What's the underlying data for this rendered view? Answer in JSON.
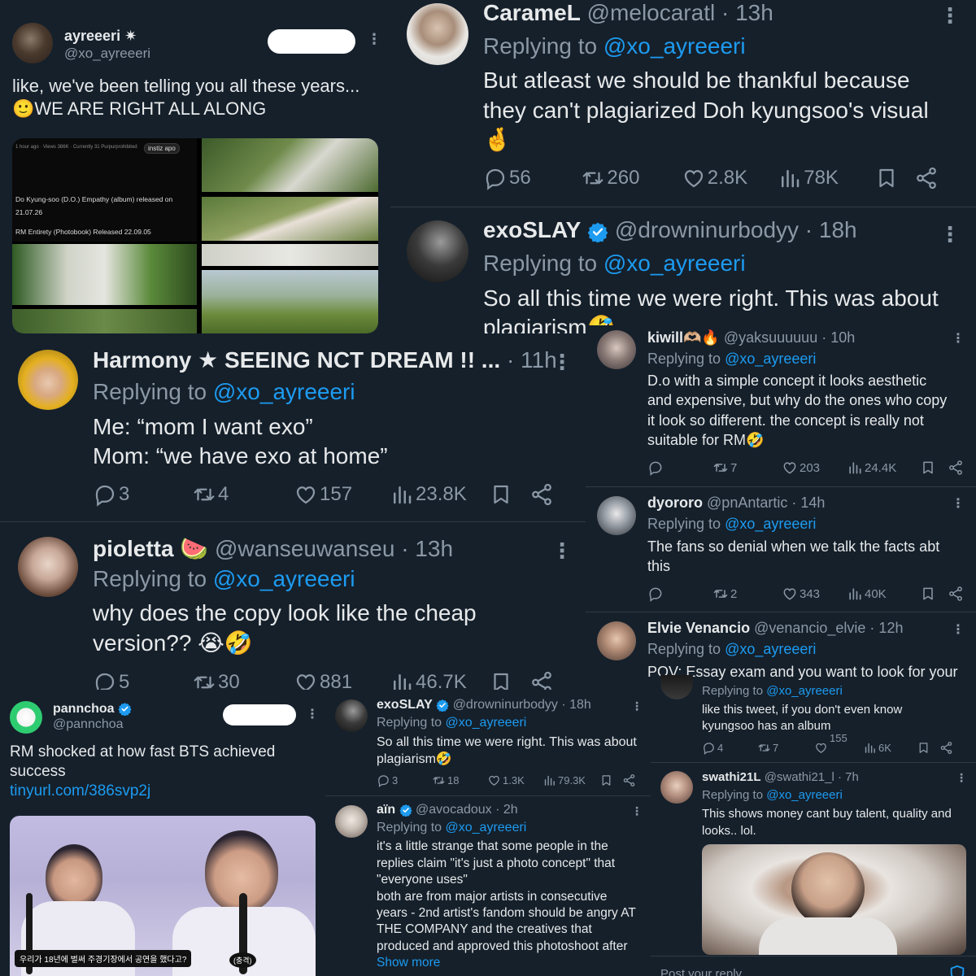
{
  "p1": {
    "name": "ayreeeri ✷",
    "handle": "@xo_ayreeeri",
    "text1": "like, we've been telling you all these years...",
    "text2": "🙂WE ARE RIGHT ALL ALONG",
    "img": {
      "top_left": "1 hour ago  ·  Views 386K · Currently 31  Purpurprohibited",
      "tag": "instiz apo",
      "cap1": "Do Kyung-soo (D.O.) Empathy (album) released on",
      "cap2": "21.07.26",
      "cap3": "RM Entirety (Photobook) Released 22.09.05"
    }
  },
  "p2": {
    "name": "CarameL",
    "meta": "@melocaratl · 13h",
    "replying": "Replying to",
    "reply_to": "@xo_ayreeeri",
    "text1": "But atleast we should be thankful because",
    "text2": "they can't plagiarized Doh kyungsoo's visual",
    "text3": "🤞",
    "actions": {
      "reply": "56",
      "rt": "260",
      "like": "2.8K",
      "views": "78K"
    }
  },
  "p3": {
    "name": "exoSLAY",
    "meta": "@drowninurbodyy · 18h",
    "replying": "Replying to",
    "reply_to": "@xo_ayreeeri",
    "text1": "So all this time we were right. This was about",
    "text2": "plagiarism🤣"
  },
  "p4": {
    "name": "Harmony ★ SEEING NCT DREAM !! ...",
    "meta": "· 11h",
    "replying": "Replying to",
    "reply_to": "@xo_ayreeeri",
    "text1": "Me: “mom I want exo”",
    "text2": "Mom: “we have exo at home”",
    "actions": {
      "reply": "3",
      "rt": "4",
      "like": "157",
      "views": "23.8K"
    }
  },
  "p5": {
    "name": "pioletta 🍉",
    "meta": "@wanseuwanseu · 13h",
    "replying": "Replying to",
    "reply_to": "@xo_ayreeeri",
    "text1": "why does the copy look like the cheap",
    "text2": "version?? 😭🤣",
    "actions": {
      "reply": "5",
      "rt": "30",
      "like": "881",
      "views": "46.7K"
    }
  },
  "p6": {
    "kiwill": {
      "name": "kiwill🫶🏼🔥",
      "meta": "@yaksuuuuuu · 10h",
      "replying": "Replying to",
      "reply_to": "@xo_ayreeeri",
      "lines": [
        "D.o with a simple concept it looks aesthetic",
        "and expensive, but why do the ones who copy",
        "it look so different. the concept is really not",
        "suitable for RM🤣"
      ],
      "actions": {
        "reply": "",
        "rt": "7",
        "like": "203",
        "views": "24.4K"
      }
    },
    "dyororo": {
      "name": "dyororo",
      "meta": "@pnAntartic · 14h",
      "replying": "Replying to",
      "reply_to": "@xo_ayreeeri",
      "lines": [
        "The fans so denial when we talk the facts abt",
        "this"
      ],
      "actions": {
        "reply": "",
        "rt": "2",
        "like": "343",
        "views": "40K"
      }
    },
    "elvie": {
      "name": "Elvie Venancio",
      "meta": "@venancio_elvie · 12h",
      "replying": "Replying to",
      "reply_to": "@xo_ayreeeri",
      "line": "POV: Essay exam and you want to look for your"
    },
    "nested": {
      "replying": "Replying to",
      "reply_to": "@xo_ayreeeri",
      "lines": [
        "like this tweet, if you don't even know",
        "kyungsoo has an album"
      ],
      "actions": {
        "reply": "4",
        "rt": "7",
        "like": "155",
        "views": "6K"
      }
    },
    "swathi": {
      "name": "swathi21L",
      "meta": "@swathi21_l · 7h",
      "replying": "Replying to",
      "reply_to": "@xo_ayreeeri",
      "lines": [
        "This shows money cant buy talent, quality and",
        "looks.. lol."
      ]
    },
    "post_reply": "Post your reply"
  },
  "p7": {
    "name": "pannchoa",
    "handle": "@pannchoa",
    "text1": "RM shocked at how fast BTS achieved",
    "text2": "success",
    "link": "tinyurl.com/386svp2j",
    "subtitle": "우리가 18년에 벌써 주경기장에서 공연을 했다고?",
    "subtitle_tag": "(충격)"
  },
  "p8": {
    "exoslay": {
      "name": "exoSLAY",
      "meta": "@drowninurbodyy · 18h",
      "replying": "Replying to",
      "reply_to": "@xo_ayreeeri",
      "lines": [
        "So all this time we were right. This was about",
        "plagiarism🤣"
      ],
      "actions": {
        "reply": "3",
        "rt": "18",
        "like": "1.3K",
        "views": "79.3K"
      }
    },
    "ain": {
      "name": "aïn",
      "meta": "@avocadoux · 2h",
      "replying": "Replying to",
      "reply_to": "@xo_ayreeeri",
      "lines": [
        "it's a little strange that some people in the",
        "replies claim \"it's just a photo concept\" that",
        "\"everyone uses\"",
        "both are from major artists in consecutive",
        "years - 2nd artist's fandom should be angry AT",
        "THE COMPANY and the creatives that",
        "produced and approved this photoshoot after"
      ],
      "show_more": "Show more"
    }
  },
  "colors": {
    "bg": "#15202b",
    "text": "#e7e9ea",
    "muted": "#8b98a5",
    "link": "#1d9bf0"
  }
}
